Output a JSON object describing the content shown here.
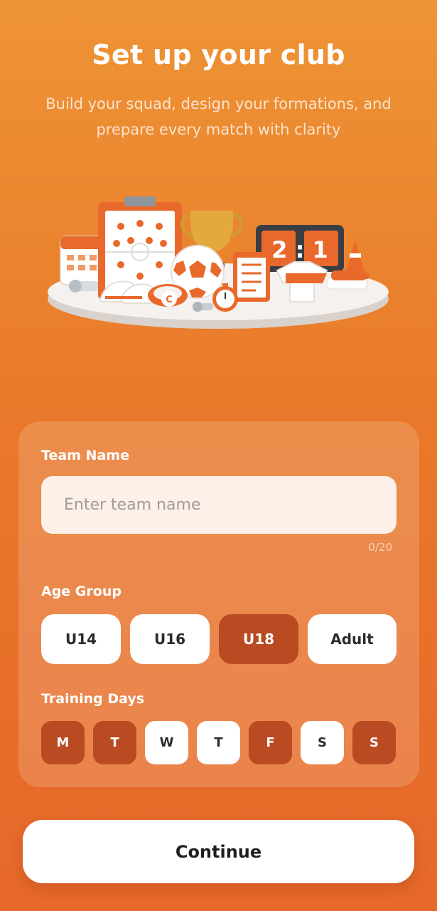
{
  "header": {
    "title": "Set up your club",
    "subtitle": "Build your squad, design your formations, and prepare every match with clarity"
  },
  "hero": {
    "scoreboard": "2 : 1",
    "armband_letter": "C"
  },
  "form": {
    "team_name": {
      "label": "Team Name",
      "placeholder": "Enter team name",
      "value": "",
      "char_count": "0/20"
    },
    "age_group": {
      "label": "Age Group",
      "options": [
        "U14",
        "U16",
        "U18",
        "Adult"
      ],
      "selected": "U18"
    },
    "training_days": {
      "label": "Training Days",
      "days": [
        {
          "label": "M",
          "selected": true
        },
        {
          "label": "T",
          "selected": true
        },
        {
          "label": "W",
          "selected": false
        },
        {
          "label": "T",
          "selected": false
        },
        {
          "label": "F",
          "selected": true
        },
        {
          "label": "S",
          "selected": false
        },
        {
          "label": "S",
          "selected": true
        }
      ]
    }
  },
  "footer": {
    "continue_label": "Continue"
  },
  "colors": {
    "background_top": "#EE9436",
    "background_bottom": "#E6682A",
    "accent_selected": "#B94A21",
    "button_bg": "#FFFFFF"
  }
}
